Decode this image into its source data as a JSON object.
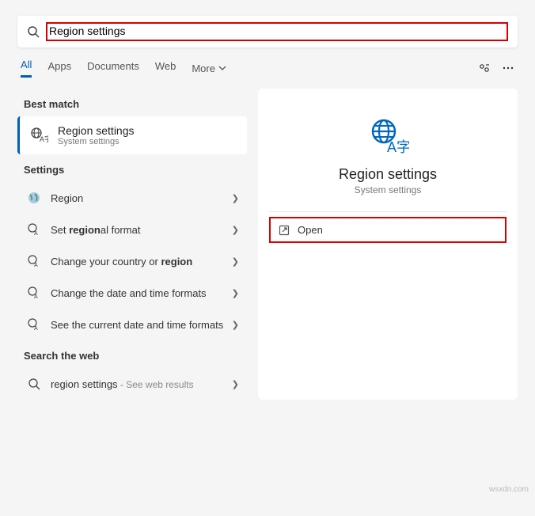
{
  "search": {
    "value": "Region settings"
  },
  "tabs": {
    "all": "All",
    "apps": "Apps",
    "documents": "Documents",
    "web": "Web",
    "more": "More"
  },
  "bestMatch": {
    "label": "Best match",
    "title": "Region settings",
    "sub": "System settings"
  },
  "settings": {
    "label": "Settings",
    "items": [
      {
        "text": "Region"
      },
      {
        "pre": "Set ",
        "bold": "region",
        "post": "al format"
      },
      {
        "pre": "Change your country or ",
        "bold": "region",
        "post": ""
      },
      {
        "text": "Change the date and time formats"
      },
      {
        "text": "See the current date and time formats"
      }
    ]
  },
  "searchWeb": {
    "label": "Search the web",
    "query": "region settings",
    "suffix": " - See web results"
  },
  "detail": {
    "title": "Region settings",
    "sub": "System settings",
    "open": "Open"
  },
  "watermark": "wsxdn.com"
}
